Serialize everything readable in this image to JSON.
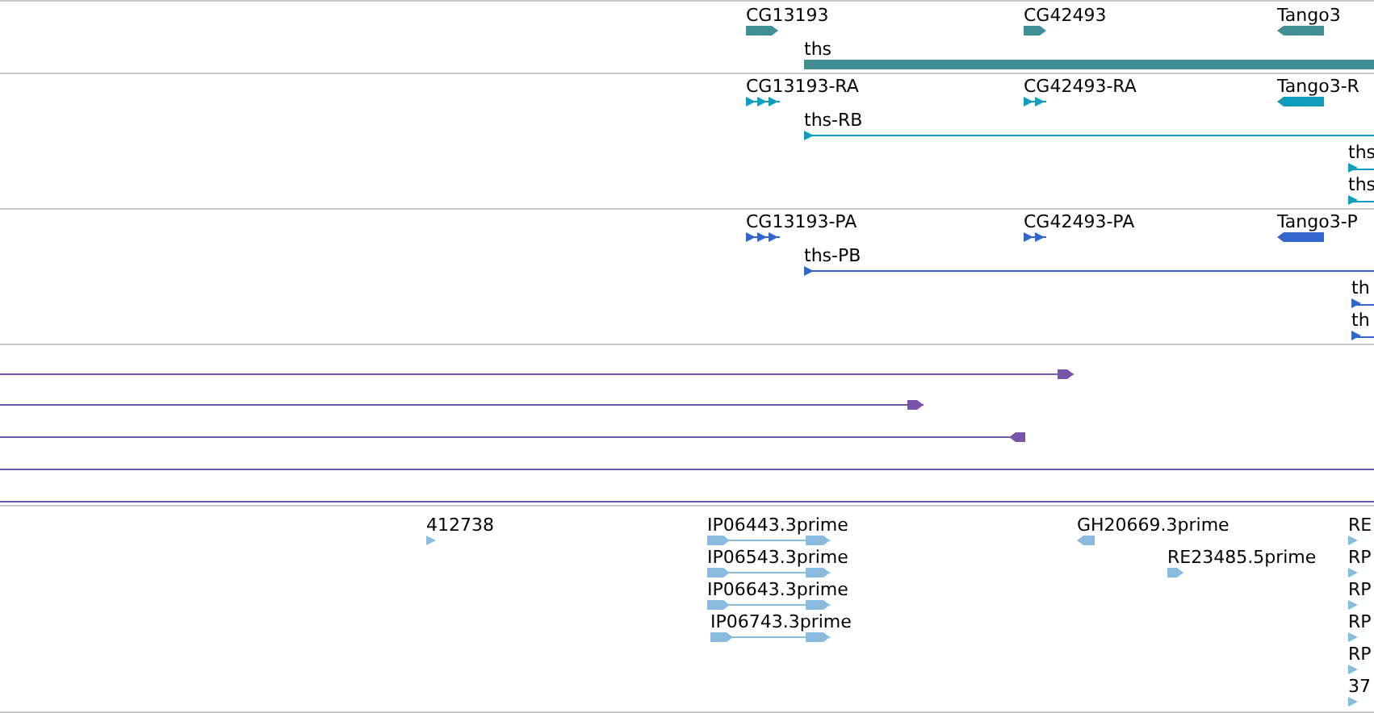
{
  "tracks": [
    {
      "color": "#3f8f94",
      "features": [
        {
          "label": "CG13193",
          "kind": "gene",
          "reverse": false
        },
        {
          "label": "CG42493",
          "kind": "gene",
          "reverse": false
        },
        {
          "label": "Tango3",
          "kind": "gene",
          "reverse": true
        },
        {
          "label": "ths",
          "kind": "bar"
        }
      ]
    },
    {
      "color": "#109cbc",
      "features": [
        {
          "label": "CG13193-RA",
          "kind": "exons",
          "reverse": false
        },
        {
          "label": "CG42493-RA",
          "kind": "exons",
          "reverse": false
        },
        {
          "label": "Tango3-R",
          "kind": "gene",
          "reverse": true
        },
        {
          "label": "ths-RB",
          "kind": "line",
          "reverse": false
        },
        {
          "label": "ths",
          "kind": "stub",
          "reverse": false
        },
        {
          "label": "ths",
          "kind": "stub",
          "reverse": false
        }
      ]
    },
    {
      "color": "#3366cc",
      "features": [
        {
          "label": "CG13193-PA",
          "kind": "exons",
          "reverse": false
        },
        {
          "label": "CG42493-PA",
          "kind": "exons",
          "reverse": false
        },
        {
          "label": "Tango3-P",
          "kind": "gene",
          "reverse": true
        },
        {
          "label": "ths-PB",
          "kind": "line",
          "reverse": false
        },
        {
          "label": "th",
          "kind": "stub",
          "reverse": false
        },
        {
          "label": "th",
          "kind": "stub",
          "reverse": false
        }
      ]
    },
    {
      "color": "#7755aa",
      "features": [
        {
          "kind": "long",
          "reverse": false
        },
        {
          "kind": "long",
          "reverse": false
        },
        {
          "kind": "long",
          "reverse": true
        },
        {
          "kind": "span"
        },
        {
          "kind": "span"
        }
      ]
    },
    {
      "color": "#88bbdd",
      "features": [
        {
          "label": "412738",
          "kind": "tri",
          "reverse": false
        },
        {
          "label": "IP06443.3prime",
          "kind": "paired",
          "reverse": false
        },
        {
          "label": "IP06543.3prime",
          "kind": "paired",
          "reverse": false
        },
        {
          "label": "IP06643.3prime",
          "kind": "paired",
          "reverse": false
        },
        {
          "label": "IP06743.3prime",
          "kind": "paired",
          "reverse": false
        },
        {
          "label": "GH20669.3prime",
          "kind": "gene",
          "reverse": true
        },
        {
          "label": "RE23485.5prime",
          "kind": "gene",
          "reverse": false
        },
        {
          "label": "RE",
          "kind": "tri",
          "reverse": false
        },
        {
          "label": "RP",
          "kind": "tri",
          "reverse": false
        },
        {
          "label": "RP",
          "kind": "tri",
          "reverse": false
        },
        {
          "label": "RP",
          "kind": "tri",
          "reverse": false
        },
        {
          "label": "RP",
          "kind": "tri",
          "reverse": false
        },
        {
          "label": "37",
          "kind": "tri",
          "reverse": false
        }
      ]
    }
  ]
}
